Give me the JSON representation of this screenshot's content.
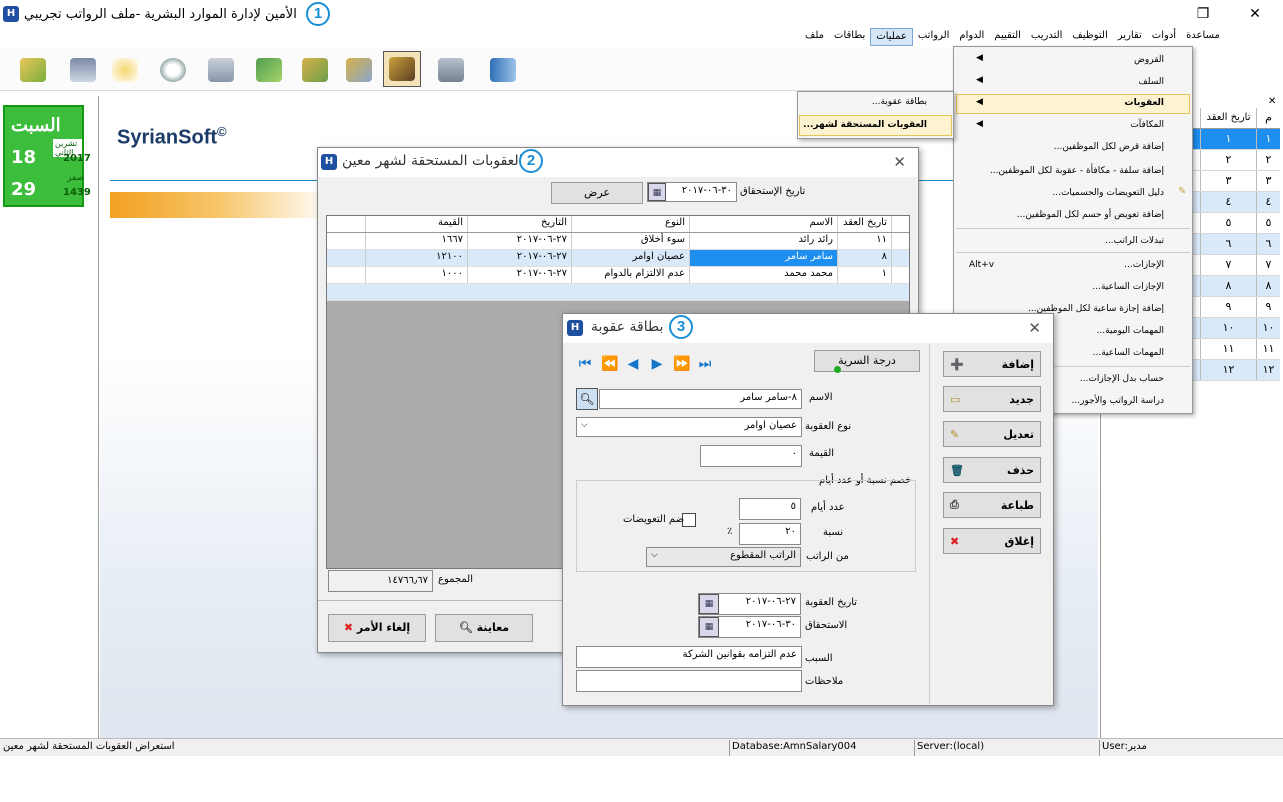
{
  "app": {
    "title": "الأمين لإدارة الموارد البشرية -ملف الرواتب تجريبي",
    "annotation": "1"
  },
  "window_controls": {
    "restore": "❐",
    "close": "✕"
  },
  "menubar": {
    "items": [
      "ملف",
      "بطاقات",
      "عمليات",
      "الرواتب",
      "الدوام",
      "التقييم",
      "التدريب",
      "التوظيف",
      "تقارير",
      "أدوات",
      "مساعدة"
    ]
  },
  "calendar": {
    "day": "السبت",
    "greg_day": "18",
    "greg_month": "تشرين الثاني",
    "greg_year": "2017",
    "hij_day": "29",
    "hij_month": "صفر",
    "hij_year": "1439"
  },
  "brand": {
    "name": "SyrianSoft",
    "mark": "©"
  },
  "dropdown": {
    "items": [
      "القروض",
      "السلف",
      "العقوبات",
      "المكافآت",
      "إضافة قرض لكل الموظفين...",
      "إضافة سلفة - مكافأة - عقوبة لكل الموظفين...",
      "دليل التعويضات والحسميات...",
      "إضافة تعويض أو حسم لكل الموظفين...",
      "تبدلات الراتب...",
      "الإجازات...",
      "الإجازات الساعية...",
      "إضافة إجازة ساعية لكل الموظفين...",
      "المهمات اليومية...",
      "المهمات الساعية...",
      "حساب بدل الإجازات...",
      "دراسة الرواتب والأجور..."
    ],
    "shortcut": "Alt+v"
  },
  "submenu": {
    "items": [
      "بطاقة عقوبة...",
      "العقوبات المستحقة لشهر..."
    ]
  },
  "right_panel": {
    "header": "تاريخ العقد",
    "header_num": "م",
    "rows": [
      {
        "num": "١",
        "val": "١"
      },
      {
        "num": "٢",
        "val": "٢"
      },
      {
        "num": "٣",
        "val": "٣"
      },
      {
        "num": "٤",
        "val": "٤"
      },
      {
        "num": "٥",
        "val": "٥"
      },
      {
        "num": "٦",
        "val": "٦"
      },
      {
        "num": "٧",
        "val": "٧"
      },
      {
        "num": "٨",
        "val": "٨"
      },
      {
        "num": "٩",
        "val": "٩"
      },
      {
        "num": "١٠",
        "val": "١٠"
      },
      {
        "num": "١١",
        "val": "١١"
      },
      {
        "num": "١٢",
        "val": "١٢"
      }
    ]
  },
  "window2": {
    "title": "العقوبات المستحقة لشهر معين",
    "annotation": "2",
    "due_date_label": "تاريخ الإستحقاق",
    "due_date_value": "٣٠-٠٦-٢٠١٧",
    "show_button": "عرض",
    "columns": [
      "تاريخ العقد",
      "الاسم",
      "النوع",
      "التاريخ",
      "القيمة"
    ],
    "rows": [
      [
        "١١",
        "رائد رائد",
        "سوء أخلاق",
        "٢٧-٠٦-٢٠١٧",
        "١٦٦٧"
      ],
      [
        "٨",
        "سامر سامر",
        "عصيان اوامر",
        "٢٧-٠٦-٢٠١٧",
        "١٢١٠٠"
      ],
      [
        "١",
        "محمد محمد",
        "عدم الالتزام بالدوام",
        "٢٧-٠٦-٢٠١٧",
        "١٠٠٠"
      ]
    ],
    "sum_label": "المجموع",
    "sum_value": "١٤٧٦٦٫٦٧",
    "preview_button": "معاينة",
    "cancel_button": "إلغاء الأمر"
  },
  "window3": {
    "title": "بطاقة عقوبة",
    "annotation": "3",
    "secrecy_button": "درجة السرية",
    "name_label": "الاسم",
    "name_value": "٨-سامر سامر",
    "type_label": "نوع العقوبة",
    "type_value": "عصيان اوامر",
    "value_label": "القيمة",
    "value_value": "٠",
    "deduct_group": "خصم نسبة أو عدد أيام",
    "days_label": "عدد أيام",
    "days_value": "٥",
    "percent_label": "نسبة",
    "percent_value": "٢٠",
    "percent_sign": "٪",
    "comp_label": "ضم التعويضات",
    "from_salary_label": "من الراتب",
    "from_salary_value": "الراتب المقطوع",
    "penalty_date_label": "تاريخ العقوبة",
    "penalty_date_value": "٢٧-٠٦-٢٠١٧",
    "due_label": "الاستحقاق",
    "due_value": "٣٠-٠٦-٢٠١٧",
    "reason_label": "السبب",
    "reason_value": "عدم التزامه بقوانين الشركة",
    "notes_label": "ملاحظات",
    "notes_value": "",
    "buttons": {
      "add": "إضافة",
      "new": "جديد",
      "edit": "تعديل",
      "delete": "حذف",
      "print": "طباعة",
      "close": "إغلاق"
    }
  },
  "status": {
    "left": "استعراض العقوبات المستحقة لشهر معين",
    "db": "Database:AmnSalary004",
    "server": "Server:(local)",
    "user": "User:مدير"
  }
}
